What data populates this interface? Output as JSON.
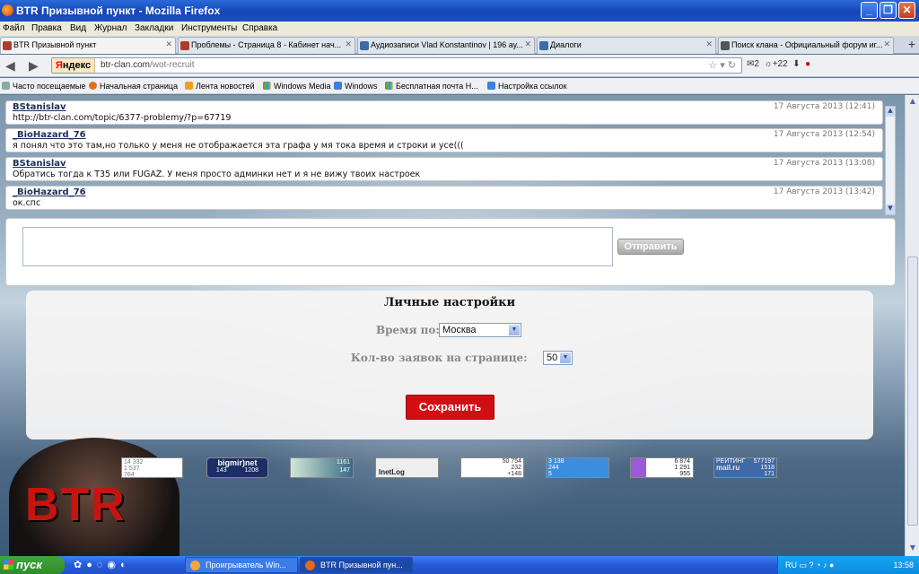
{
  "window": {
    "title": "BTR Призывной пункт - Mozilla Firefox"
  },
  "menu": [
    "Файл",
    "Правка",
    "Вид",
    "Журнал",
    "Закладки",
    "Инструменты",
    "Справка"
  ],
  "tabs": [
    {
      "label": "BTR Призывной пункт"
    },
    {
      "label": "Проблемы - Страница 8 - Кабинет нач..."
    },
    {
      "label": "Аудиозаписи Vlad Konstantinov | 196 ау..."
    },
    {
      "label": "Диалоги"
    },
    {
      "label": "Поиск клана - Официальный форум иг..."
    }
  ],
  "nav": {
    "yandex_y": "Я",
    "yandex_rest": "ндекс",
    "url_host": "btr-clan.com",
    "url_path": "/wot-recruit",
    "mail_count": "2",
    "weather": "+22"
  },
  "bookmarks": [
    "Часто посещаемые",
    "Начальная страница",
    "Лента новостей",
    "Windows Media",
    "Windows",
    "Бесплатная почта Н...",
    "Настройка ссылок"
  ],
  "chat": {
    "messages": [
      {
        "author": "BStanislav",
        "time": "17 Августа 2013 (12:41)",
        "text": "http://btr-clan.com/topic/6377-problemy/?p=67719"
      },
      {
        "author": "_BioHazard_76",
        "time": "17 Августа 2013 (12:54)",
        "text": "я понял что это там,но только у меня не отображается эта графа у мя тока время и строки и усе((("
      },
      {
        "author": "BStanislav",
        "time": "17 Августа 2013 (13:08)",
        "text": "Обратись тогда к Т35 или FUGAZ. У меня просто админки нет и я не вижу твоих настроек"
      },
      {
        "author": "_BioHazard_76",
        "time": "17 Августа 2013 (13:42)",
        "text": "ок.спс"
      }
    ],
    "send_label": "Отправить"
  },
  "settings": {
    "title": "Личные настройки",
    "time_label": "Время по:",
    "time_value": "Москва",
    "count_label": "Кол-во заявок на странице:",
    "count_value": "50",
    "save_label": "Сохранить"
  },
  "logo_text": "BTR",
  "counters": [
    {
      "name": "liveinternet",
      "l1": "14 332",
      "l2": "1 537",
      "l3": "764"
    },
    {
      "name": "bigmir",
      "title": "bigmir)net",
      "a": "143",
      "b": "1208"
    },
    {
      "name": "counter-3",
      "a": "1161",
      "b": "147"
    },
    {
      "name": "inetlog",
      "title": "InetLog"
    },
    {
      "name": "hotlog",
      "a": "50 754",
      "b": "232",
      "c": "+148"
    },
    {
      "name": "counter-6",
      "a": "3 138",
      "b": "244",
      "c": "5"
    },
    {
      "name": "counter-7",
      "a": "6 874",
      "b": "1 291",
      "c": "955"
    },
    {
      "name": "mailru",
      "title": "mail.ru",
      "r": "РЕЙТИНГ",
      "a": "577197",
      "b": "1518",
      "c": "171"
    }
  ],
  "taskbar": {
    "start": "пуск",
    "tasks": [
      {
        "label": "Проигрыватель Win..."
      },
      {
        "label": "BTR Призывной пун..."
      }
    ],
    "lang": "RU",
    "clock": "13:58"
  }
}
